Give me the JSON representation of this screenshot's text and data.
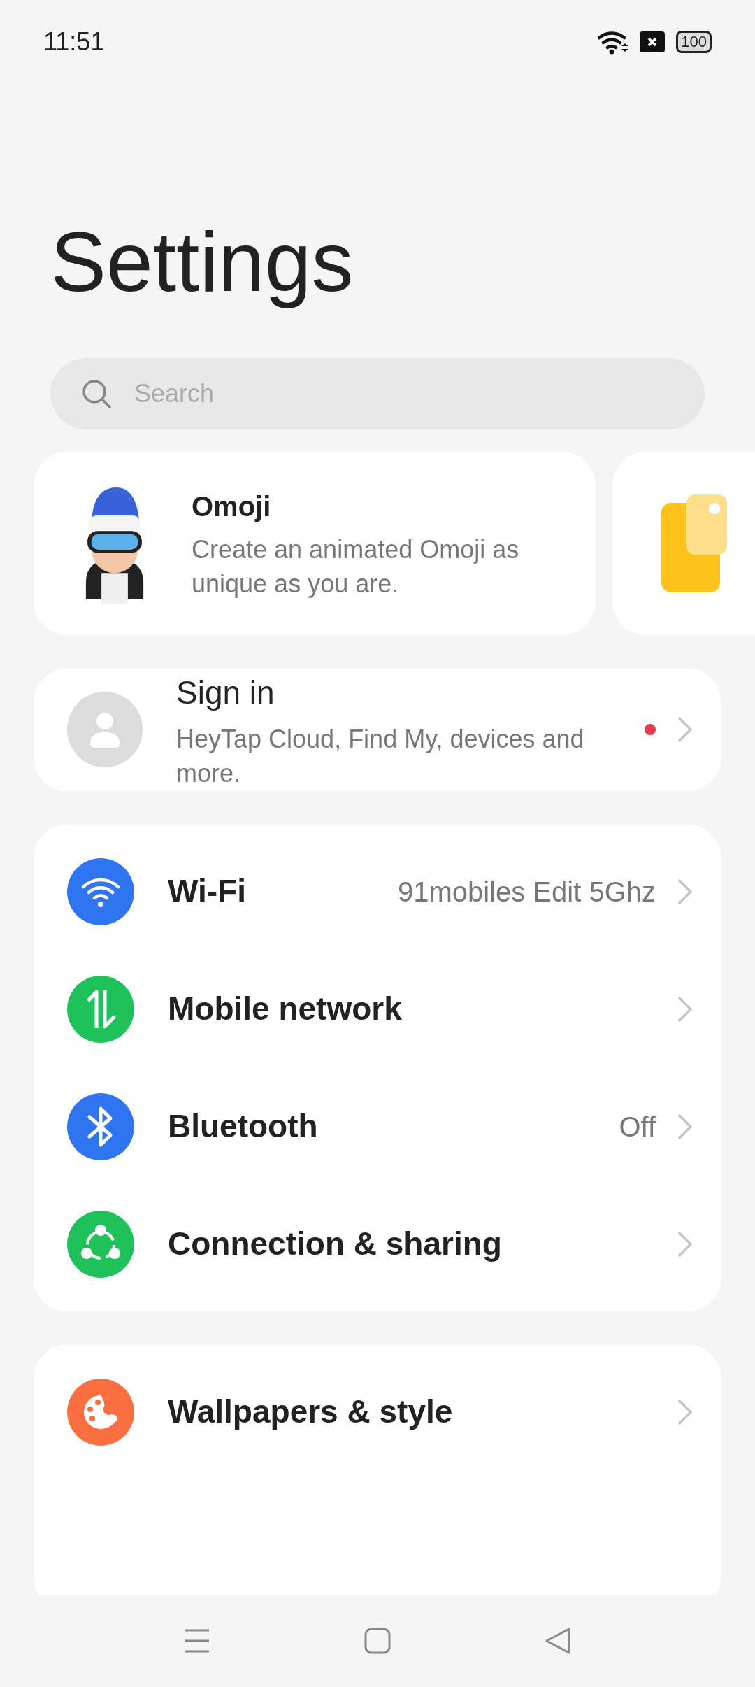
{
  "status_bar": {
    "time": "11:51",
    "battery": "100"
  },
  "title": "Settings",
  "search": {
    "placeholder": "Search"
  },
  "promo_cards": [
    {
      "kind": "omoji",
      "title": "Omoji",
      "description": "Create an animated Omoji as unique as you are."
    },
    {
      "kind": "cards"
    }
  ],
  "account": {
    "title": "Sign in",
    "subtitle": "HeyTap Cloud, Find My, devices and more.",
    "notification": true
  },
  "sections": [
    {
      "items": [
        {
          "kind": "wifi",
          "label": "Wi-Fi",
          "value": "91mobiles Edit 5Ghz"
        },
        {
          "kind": "mobile",
          "label": "Mobile network"
        },
        {
          "kind": "bluetooth",
          "label": "Bluetooth",
          "value": "Off"
        },
        {
          "kind": "sharing",
          "label": "Connection & sharing"
        }
      ]
    },
    {
      "items": [
        {
          "kind": "wallpaper",
          "label": "Wallpapers & style"
        }
      ]
    }
  ]
}
